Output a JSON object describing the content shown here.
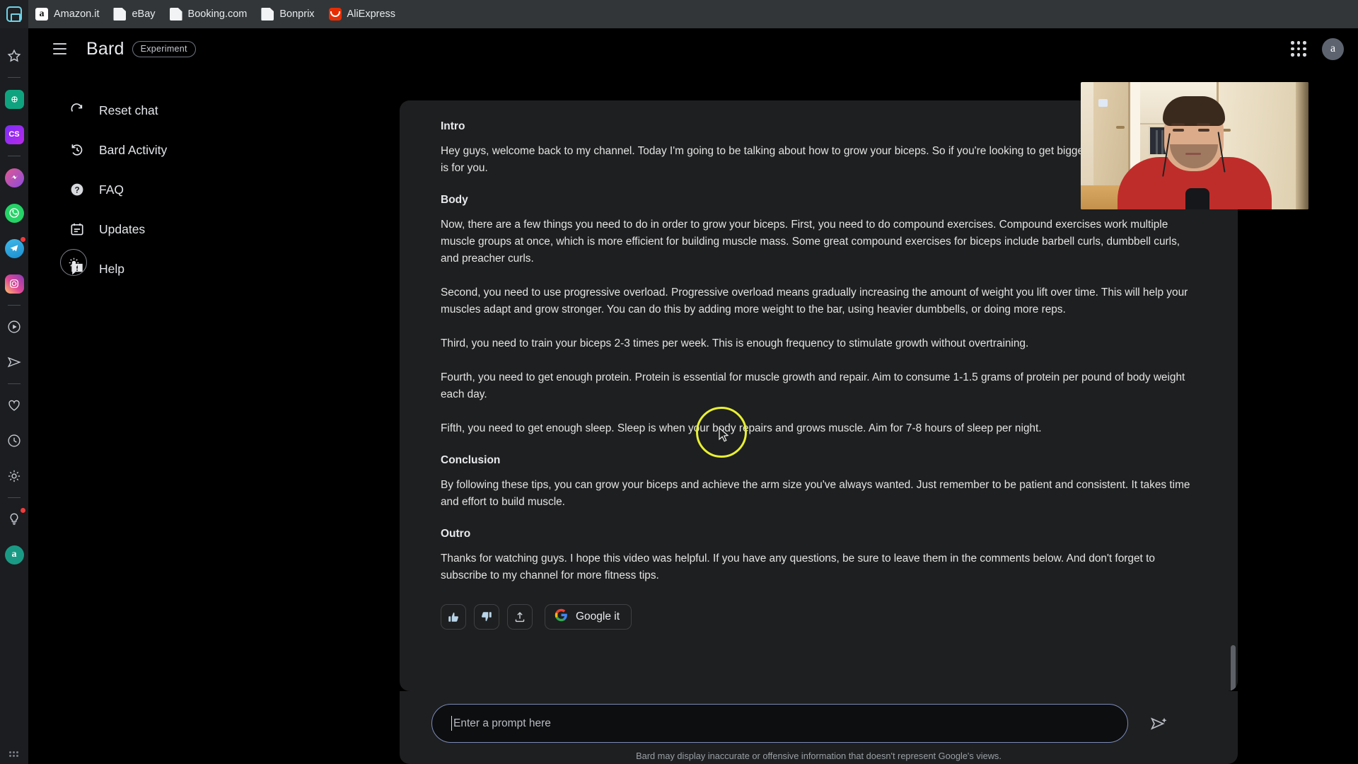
{
  "browser": {
    "home_tile_icon": "home-icon",
    "bookmarks": [
      {
        "label": "Amazon.it",
        "icon": "amazon-icon",
        "glyph": "a"
      },
      {
        "label": "eBay",
        "icon": "page-icon",
        "glyph": ""
      },
      {
        "label": "Booking.com",
        "icon": "page-icon",
        "glyph": ""
      },
      {
        "label": "Bonprix",
        "icon": "page-icon",
        "glyph": ""
      },
      {
        "label": "AliExpress",
        "icon": "aliexpress-icon",
        "glyph": ""
      }
    ]
  },
  "app_rail": {
    "items": [
      {
        "icon": "star-outline-icon",
        "type": "outline"
      },
      {
        "icon": "separator",
        "type": "separator"
      },
      {
        "icon": "chatgpt-icon",
        "type": "tile",
        "glyph": "◎",
        "color": "#10a37f"
      },
      {
        "icon": "cs-icon",
        "type": "tile",
        "glyph": "CS",
        "color": "#8d2ff0"
      },
      {
        "icon": "separator",
        "type": "separator"
      },
      {
        "icon": "messenger-icon",
        "type": "tile",
        "glyph": "⚡",
        "color": "#b84ccf"
      },
      {
        "icon": "whatsapp-icon",
        "type": "tile",
        "glyph": "✆",
        "color": "#25d366"
      },
      {
        "icon": "telegram-icon",
        "type": "tile",
        "glyph": "➤",
        "color": "#2d9fd9",
        "badge": true
      },
      {
        "icon": "instagram-icon",
        "type": "tile",
        "glyph": "◎",
        "color": "#df4996"
      },
      {
        "icon": "separator",
        "type": "separator"
      },
      {
        "icon": "play-circle-icon",
        "type": "outline"
      },
      {
        "icon": "send-outline-icon",
        "type": "outline"
      },
      {
        "icon": "separator",
        "type": "separator"
      },
      {
        "icon": "heart-outline-icon",
        "type": "outline"
      },
      {
        "icon": "clock-outline-icon",
        "type": "outline"
      },
      {
        "icon": "gear-outline-icon",
        "type": "outline"
      },
      {
        "icon": "separator",
        "type": "separator"
      },
      {
        "icon": "bulb-outline-icon",
        "type": "outline",
        "badge": true
      },
      {
        "icon": "account-icon",
        "type": "tile",
        "glyph": "a",
        "color": "#1a9a84"
      }
    ]
  },
  "header": {
    "hamburger_icon": "hamburger-icon",
    "title": "Bard",
    "chip": "Experiment",
    "apps_grid_icon": "apps-grid-icon",
    "avatar_initial": "a"
  },
  "nav": {
    "items": [
      {
        "label": "Reset chat",
        "icon": "reset-icon"
      },
      {
        "label": "Bard Activity",
        "icon": "history-icon"
      },
      {
        "label": "FAQ",
        "icon": "question-mark-icon"
      },
      {
        "label": "Updates",
        "icon": "calendar-icon"
      },
      {
        "label": "Help",
        "icon": "announcement-icon"
      }
    ],
    "theme_toggle_icon": "brightness-icon"
  },
  "conversation": {
    "blocks": [
      {
        "kind": "heading",
        "text": "Intro"
      },
      {
        "kind": "paragraph",
        "text": "Hey guys, welcome back to my channel. Today I'm going to be talking about how to grow your biceps. So if you're looking to get bigger arms, then this video is for you."
      },
      {
        "kind": "heading",
        "text": "Body"
      },
      {
        "kind": "paragraph",
        "text": "Now, there are a few things you need to do in order to grow your biceps. First, you need to do compound exercises. Compound exercises work multiple muscle groups at once, which is more efficient for building muscle mass. Some great compound exercises for biceps include barbell curls, dumbbell curls, and preacher curls."
      },
      {
        "kind": "paragraph",
        "text": "Second, you need to use progressive overload. Progressive overload means gradually increasing the amount of weight you lift over time. This will help your muscles adapt and grow stronger. You can do this by adding more weight to the bar, using heavier dumbbells, or doing more reps."
      },
      {
        "kind": "paragraph",
        "text": "Third, you need to train your biceps 2-3 times per week. This is enough frequency to stimulate growth without overtraining."
      },
      {
        "kind": "paragraph",
        "text": "Fourth, you need to get enough protein. Protein is essential for muscle growth and repair. Aim to consume 1-1.5 grams of protein per pound of body weight each day."
      },
      {
        "kind": "paragraph",
        "text": "Fifth, you need to get enough sleep. Sleep is when your body repairs and grows muscle. Aim for 7-8 hours of sleep per night."
      },
      {
        "kind": "heading",
        "text": "Conclusion"
      },
      {
        "kind": "paragraph",
        "text": "By following these tips, you can grow your biceps and achieve the arm size you've always wanted. Just remember to be patient and consistent. It takes time and effort to build muscle."
      },
      {
        "kind": "heading",
        "text": "Outro"
      },
      {
        "kind": "paragraph",
        "text": "Thanks for watching guys. I hope this video was helpful. If you have any questions, be sure to leave them in the comments below. And don't forget to subscribe to my channel for more fitness tips."
      }
    ],
    "actions": {
      "thumb_up_icon": "thumb-up-icon",
      "thumb_down_icon": "thumb-down-icon",
      "share_icon": "share-upload-icon",
      "google_it_label": "Google it",
      "google_icon": "google-g-icon",
      "more_options_icon": "kebab-menu-icon"
    }
  },
  "composer": {
    "placeholder": "Enter a prompt here",
    "value": "",
    "send_icon": "send-icon",
    "disclaimer": "Bard may display inaccurate or offensive information that doesn't represent Google's views."
  },
  "webcam_overlay": {
    "name": "webcam-pip",
    "description": "Live webcam feed of a man in a red t-shirt with earphones, seated in front of cream-colored wardrobe doors."
  },
  "pointer": {
    "cursor_icon": "mouse-cursor",
    "click_highlight_color": "#e8f034"
  },
  "colors": {
    "page_background": "#000000",
    "panel_background": "#1e1f20",
    "chrome_background": "#323639",
    "rail_background": "#1b1d21",
    "text_primary": "#e3e3e3",
    "text_muted": "#9aa0a6",
    "composer_border": "#7b8ab8",
    "highlight": "#e8f034"
  }
}
